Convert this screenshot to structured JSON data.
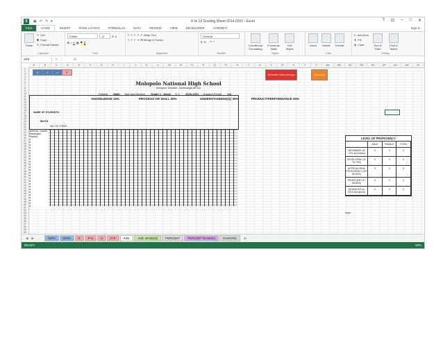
{
  "window": {
    "title": "K to 12 Grading Sheet 2014-2015 - Excel",
    "sign_in": "Sign in",
    "controls": [
      "?",
      "⊡",
      "–",
      "□",
      "✕"
    ]
  },
  "ribbon_tabs": [
    "FILE",
    "HOME",
    "INSERT",
    "PAGE LAYOUT",
    "FORMULAS",
    "DATA",
    "REVIEW",
    "VIEW",
    "DEVELOPER",
    "ACROBAT"
  ],
  "ribbon": {
    "clipboard": {
      "paste": "Paste",
      "cut": "Cut",
      "copy": "Copy",
      "painter": "Format Painter",
      "label": "Clipboard"
    },
    "font": {
      "name": "Calibri",
      "size": "11",
      "label": "Font",
      "bold": "B",
      "italic": "I",
      "underline": "U"
    },
    "alignment": {
      "wrap": "Wrap Text",
      "merge": "Merge & Center",
      "label": "Alignment"
    },
    "number": {
      "format": "General",
      "label": "Number",
      "currency": "$",
      "percent": "%"
    },
    "styles": {
      "cond": "Conditional Formatting",
      "table": "Format as Table",
      "cell": "Cell Styles",
      "label": "Styles"
    },
    "cells": {
      "insert": "Insert",
      "delete": "Delete",
      "format": "Format",
      "label": "Cells"
    },
    "editing": {
      "autosum": "AutoSum",
      "fill": "Fill",
      "clear": "Clear",
      "sort": "Sort & Filter",
      "find": "Find & Select",
      "label": "Editing"
    }
  },
  "formula_bar": {
    "name_box": "AF8",
    "fx": "fx"
  },
  "columns": [
    "A",
    "B",
    "C",
    "D",
    "E",
    "F",
    "G",
    "H",
    "I",
    "J",
    "K",
    "L",
    "M",
    "N",
    "O",
    "P",
    "Q",
    "R",
    "S",
    "T",
    "U",
    "V",
    "W",
    "X",
    "Y",
    "Z",
    "AA",
    "AB",
    "AC",
    "AD",
    "AE",
    "AF",
    "AG",
    "AH",
    "AI"
  ],
  "sheet": {
    "school": "Molopolo National High School",
    "address": "Molopolo, Dinokwe, Zamboanga del Sur",
    "subject_label": "Subject",
    "subject": "Math",
    "year_label": "Year and Section",
    "year": "Grade 1 - Daisy",
    "sy_label": "S.Y.",
    "sy": "2020-2021",
    "period_label": "Grading Period",
    "period": "1st",
    "names_label": "NAME OF STUDENTS",
    "boys_label": "BOYS",
    "no_of_items": "NO. OF ITEMS",
    "bands": [
      {
        "name": "KNOWLEDGE",
        "pct": "15%"
      },
      {
        "name": "PROCESS OR SKILL",
        "pct": "25%"
      },
      {
        "name": "UNDERSTANDING(S)",
        "pct": "30%"
      },
      {
        "name": "PRODUCT/PERFORMANCE",
        "pct": "30%"
      }
    ],
    "students": [
      "Abellina, Juanito",
      "Marasigan, Paquito",
      "a",
      "a",
      "a",
      "a",
      "a",
      "a",
      "a",
      "a",
      "a",
      "a",
      "a",
      "a",
      "a",
      "a",
      "a",
      "a",
      "a",
      "a",
      "a",
      "a",
      "a",
      "a",
      "a",
      "a",
      "a"
    ],
    "top_buttons": [
      "K",
      "P",
      "U",
      "P"
    ],
    "red_button": "Generate Class Average",
    "orange_button": "Summary"
  },
  "proficiency": {
    "title": "LEVEL OF PROFICIENCY",
    "headers": [
      "",
      "MALE",
      "FEMALE",
      "TOTAL"
    ],
    "rows": [
      {
        "level": "BEGINNING (B: 74% and below)",
        "male": "0",
        "female": "0",
        "total": "0"
      },
      {
        "level": "DEVELOPING (D: 75-79%)",
        "male": "0",
        "female": "0",
        "total": "0"
      },
      {
        "level": "APPROACHING PROFICIENCY (AP: 80-84%)",
        "male": "0",
        "female": "0",
        "total": "0"
      },
      {
        "level": "PROFICIENT (P: 85-89%)",
        "male": "0",
        "female": "0",
        "total": "0"
      },
      {
        "level": "ADVANCED (A: 90% and above)",
        "male": "0",
        "female": "0",
        "total": "0"
      }
    ],
    "note": "Note:"
  },
  "sheet_tabs": [
    {
      "label": "INFO",
      "color": "#8db4e2"
    },
    {
      "label": "DATA",
      "color": "#8db4e2"
    },
    {
      "label": "K",
      "color": "#f2a6a6"
    },
    {
      "label": "P-S",
      "color": "#f2a6a6"
    },
    {
      "label": "U",
      "color": "#f2a6a6"
    },
    {
      "label": "P-P",
      "color": "#f2a6a6"
    },
    {
      "label": "AVE.",
      "color": "#ffffff"
    },
    {
      "label": "AVE. BASE(N)",
      "color": "#c4e3a7"
    },
    {
      "label": "PERCENT",
      "color": "#d9d9d9"
    },
    {
      "label": "PERCENT BASE(N)",
      "color": "#d9a6e6"
    },
    {
      "label": "RANKING",
      "color": "#d9d9d9"
    }
  ],
  "status": {
    "ready": "READY",
    "zoom": "60%"
  }
}
